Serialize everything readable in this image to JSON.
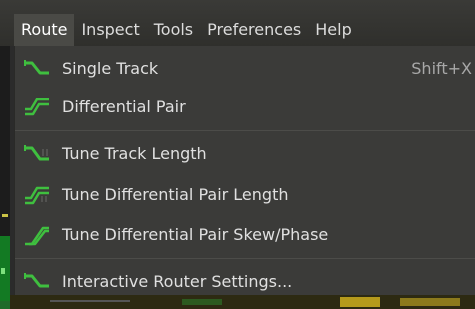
{
  "menubar": {
    "items": [
      {
        "label": "Route",
        "active": true
      },
      {
        "label": "Inspect"
      },
      {
        "label": "Tools"
      },
      {
        "label": "Preferences"
      },
      {
        "label": "Help"
      }
    ]
  },
  "route_menu": {
    "items": [
      {
        "label": "Single Track",
        "shortcut": "Shift+X",
        "icon": "single-track-icon"
      },
      {
        "label": "Differential Pair",
        "icon": "differential-pair-icon"
      },
      {
        "label": "Tune Track Length",
        "icon": "tune-track-length-icon"
      },
      {
        "label": "Tune Differential Pair Length",
        "icon": "tune-diff-pair-length-icon"
      },
      {
        "label": "Tune Differential Pair Skew/Phase",
        "icon": "tune-diff-pair-skew-icon"
      },
      {
        "label": "Interactive Router Settings...",
        "icon": "router-settings-icon"
      }
    ]
  },
  "colors": {
    "icon_green": "#3fbf3f",
    "menu_background": "#3b3b39",
    "menubar_background": "#33332f",
    "active_menu": "#4a4a46"
  }
}
